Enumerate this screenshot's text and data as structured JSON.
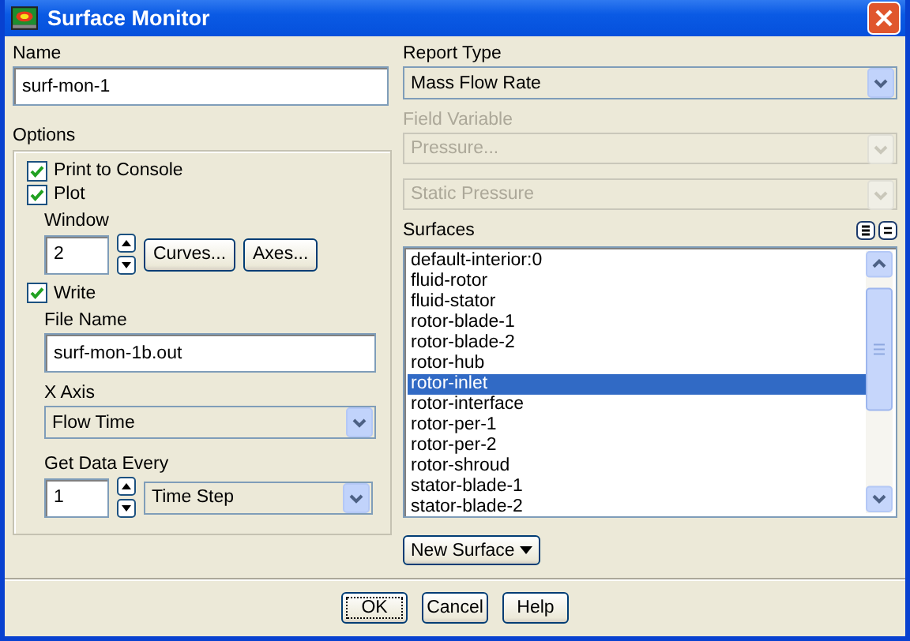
{
  "window": {
    "title": "Surface Monitor"
  },
  "name": {
    "label": "Name",
    "value": "surf-mon-1"
  },
  "options": {
    "label": "Options",
    "checks": [
      {
        "label": "Print to Console",
        "checked": true
      },
      {
        "label": "Plot",
        "checked": true
      }
    ],
    "window_field": {
      "label": "Window",
      "value": "2"
    },
    "plot_buttons": [
      "Curves...",
      "Axes..."
    ],
    "write": {
      "label": "Write",
      "checked": true
    },
    "file_name": {
      "label": "File Name",
      "value": "surf-mon-1b.out"
    },
    "x_axis": {
      "label": "X Axis",
      "value": "Flow Time"
    },
    "get_data_every": {
      "label": "Get Data Every",
      "value": "1",
      "unit": "Time Step"
    }
  },
  "report_type": {
    "label": "Report Type",
    "value": "Mass Flow Rate",
    "disabled": false
  },
  "field_variable": {
    "label": "Field Variable",
    "disabled": true,
    "values": [
      "Pressure...",
      "Static Pressure"
    ]
  },
  "surfaces": {
    "label": "Surfaces",
    "items": [
      {
        "label": "default-interior:0",
        "selected": false
      },
      {
        "label": "fluid-rotor",
        "selected": false
      },
      {
        "label": "fluid-stator",
        "selected": false
      },
      {
        "label": "rotor-blade-1",
        "selected": false
      },
      {
        "label": "rotor-blade-2",
        "selected": false
      },
      {
        "label": "rotor-hub",
        "selected": false
      },
      {
        "label": "rotor-inlet",
        "selected": true
      },
      {
        "label": "rotor-interface",
        "selected": false
      },
      {
        "label": "rotor-per-1",
        "selected": false
      },
      {
        "label": "rotor-per-2",
        "selected": false
      },
      {
        "label": "rotor-shroud",
        "selected": false
      },
      {
        "label": "stator-blade-1",
        "selected": false
      },
      {
        "label": "stator-blade-2",
        "selected": false
      }
    ]
  },
  "new_surface": "New Surface",
  "buttons": [
    {
      "label": "OK",
      "default": true
    },
    {
      "label": "Cancel",
      "default": false
    },
    {
      "label": "Help",
      "default": false
    }
  ]
}
